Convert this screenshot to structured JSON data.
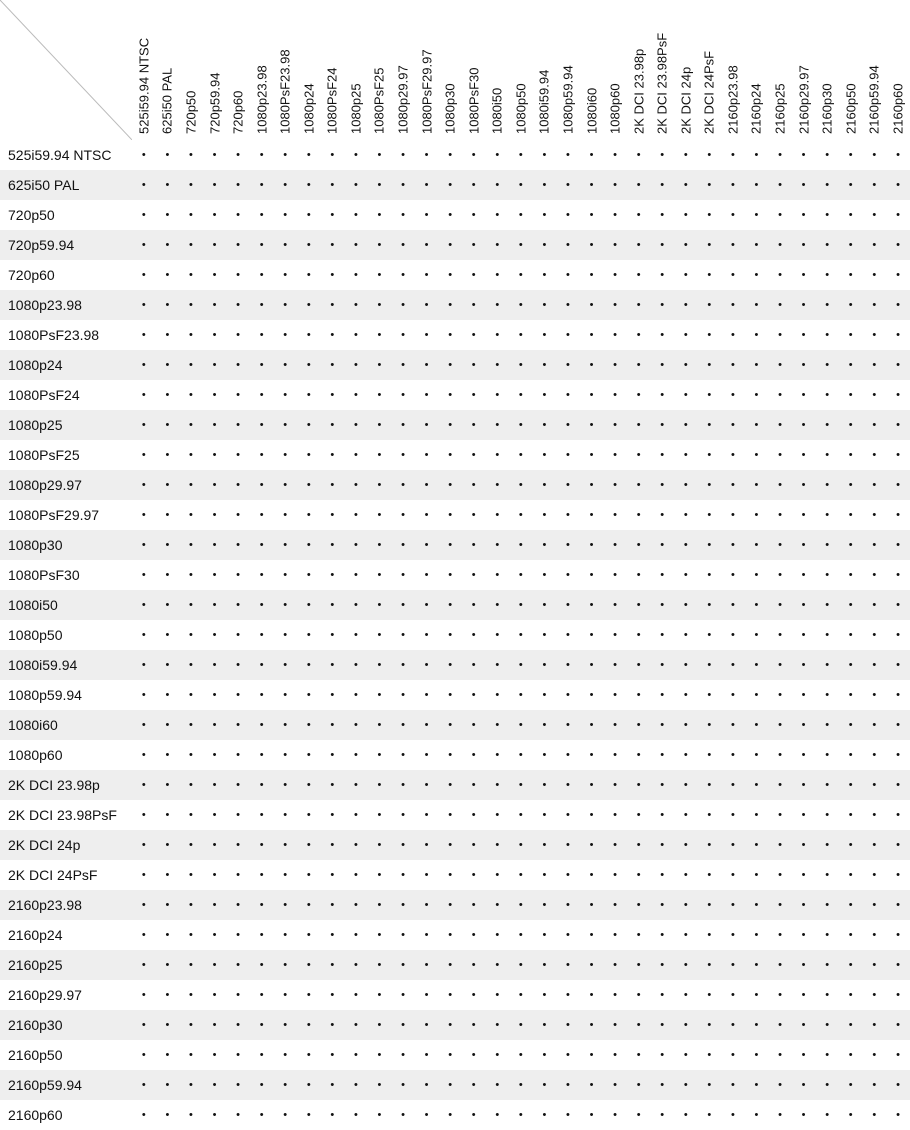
{
  "formats": [
    "525i59.94 NTSC",
    "625i50 PAL",
    "720p50",
    "720p59.94",
    "720p60",
    "1080p23.98",
    "1080PsF23.98",
    "1080p24",
    "1080PsF24",
    "1080p25",
    "1080PsF25",
    "1080p29.97",
    "1080PsF29.97",
    "1080p30",
    "1080PsF30",
    "1080i50",
    "1080p50",
    "1080i59.94",
    "1080p59.94",
    "1080i60",
    "1080p60",
    "2K DCI 23.98p",
    "2K DCI 23.98PsF",
    "2K DCI 24p",
    "2K DCI 24PsF",
    "2160p23.98",
    "2160p24",
    "2160p25",
    "2160p29.97",
    "2160p30",
    "2160p50",
    "2160p59.94",
    "2160p60"
  ],
  "dot_glyph": "•",
  "chart_data": {
    "type": "table",
    "title": "",
    "row_labels": [
      "525i59.94 NTSC",
      "625i50 PAL",
      "720p50",
      "720p59.94",
      "720p60",
      "1080p23.98",
      "1080PsF23.98",
      "1080p24",
      "1080PsF24",
      "1080p25",
      "1080PsF25",
      "1080p29.97",
      "1080PsF29.97",
      "1080p30",
      "1080PsF30",
      "1080i50",
      "1080p50",
      "1080i59.94",
      "1080p59.94",
      "1080i60",
      "1080p60",
      "2K DCI 23.98p",
      "2K DCI 23.98PsF",
      "2K DCI 24p",
      "2K DCI 24PsF",
      "2160p23.98",
      "2160p24",
      "2160p25",
      "2160p29.97",
      "2160p30",
      "2160p50",
      "2160p59.94",
      "2160p60"
    ],
    "column_labels": [
      "525i59.94 NTSC",
      "625i50 PAL",
      "720p50",
      "720p59.94",
      "720p60",
      "1080p23.98",
      "1080PsF23.98",
      "1080p24",
      "1080PsF24",
      "1080p25",
      "1080PsF25",
      "1080p29.97",
      "1080PsF29.97",
      "1080p30",
      "1080PsF30",
      "1080i50",
      "1080p50",
      "1080i59.94",
      "1080p59.94",
      "1080i60",
      "1080p60",
      "2K DCI 23.98p",
      "2K DCI 23.98PsF",
      "2K DCI 24p",
      "2K DCI 24PsF",
      "2160p23.98",
      "2160p24",
      "2160p25",
      "2160p29.97",
      "2160p30",
      "2160p50",
      "2160p59.94",
      "2160p60"
    ],
    "all_supported": true,
    "note": "Every row/column intersection cell contains a bullet (•) indicating support."
  }
}
